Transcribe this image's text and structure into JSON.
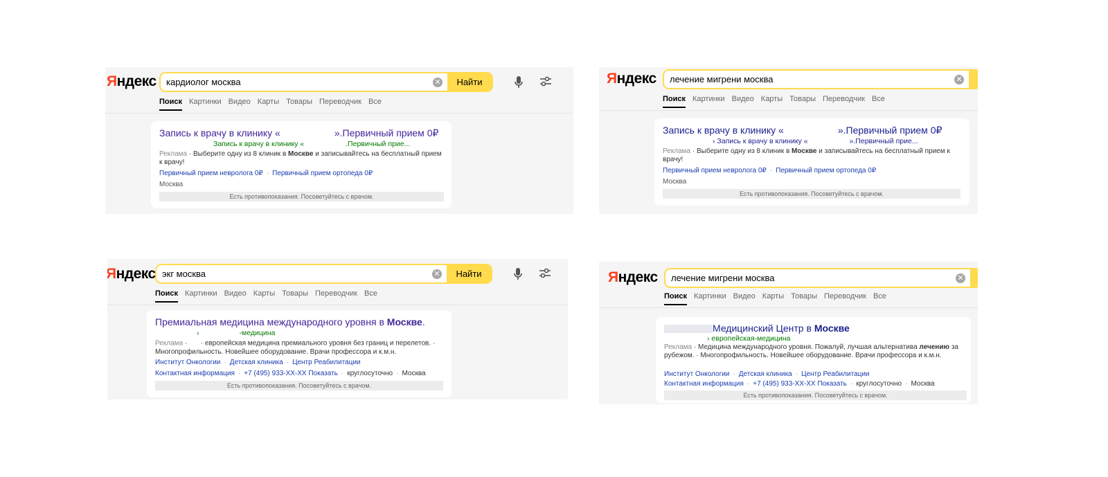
{
  "logo": {
    "first": "Я",
    "rest": "ндекс"
  },
  "tabs": [
    "Поиск",
    "Картинки",
    "Видео",
    "Карты",
    "Товары",
    "Переводчик",
    "Все"
  ],
  "find_label": "Найти",
  "clear_glyph": "✕",
  "warning": "Есть противопоказания. Посоветуйтесь с врачом.",
  "ad_label": "Реклама",
  "panels": [
    {
      "query": "кардиолог москва",
      "title_a": "Запись к врачу в клинику «",
      "title_b": "».Первичный прием 0₽",
      "url_a": "Запись к врачу в клинику «",
      "url_b": ".Первичный прие...",
      "snippet_a": " · Выберите одну из 8 клиник в ",
      "snippet_bold": "Москве",
      "snippet_b": " и записывайтесь на бесплатный прием к врачу!",
      "links": [
        "Первичный прием невролога 0₽",
        "Первичный прием ортопеда 0₽"
      ],
      "city": "Москва"
    },
    {
      "query": "лечение мигрени москва",
      "title_a": "Запись к врачу в клинику «",
      "title_b": "».Первичный прием 0₽",
      "url_a": "› Запись к врачу в клинику «",
      "url_b": "».Первичный прие...",
      "snippet_a": " · Выберите одну из 8 клиник в ",
      "snippet_bold": "Москве",
      "snippet_b": " и записывайтесь на бесплатный прием к врачу!",
      "links": [
        "Первичный прием невролога 0₽",
        "Первичный прием ортопеда 0₽"
      ],
      "city": "Москва"
    },
    {
      "query": "экг москва",
      "title_a": "Премиальная медицина международного уровня в ",
      "title_bold": "Москве",
      "title_b": ".",
      "url": "-медицина",
      "snippet_a": " · ",
      "snippet_b": " · европейская медицина премиального уровня без границ и перелетов. · Многопрофильность. Новейшее оборудование. Врачи профессора и к.м.н.",
      "links": [
        "Институт Онкологии",
        "Детская клиника",
        "Центр Реабилитации"
      ],
      "contact_link": "Контактная информация",
      "phone": "+7 (495) 933-ХХ-ХХ Показать",
      "hours": "круглосуточно",
      "city": "Москва"
    },
    {
      "query": "лечение мигрени москва",
      "title_a": "Медицинский Центр в ",
      "title_bold": "Москве",
      "url": "› европейская-медицина",
      "snippet_a": " · Медицина международного уровня. Пожалуй, лучшая альтернатива ",
      "snippet_bold": "лечению",
      "snippet_b": " за рубежом. · Многопрофильность. Новейшее оборудование. Врачи профессора и к.м.н.",
      "links": [
        "Институт Онкологии",
        "Детская клиника",
        "Центр Реабилитации"
      ],
      "contact_link": "Контактная информация",
      "phone": "+7 (495) 933-ХХ-ХХ Показать",
      "hours": "круглосуточно",
      "city": "Москва"
    }
  ]
}
